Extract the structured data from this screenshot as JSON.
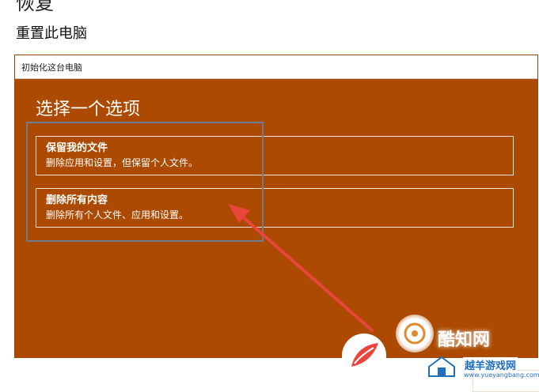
{
  "page": {
    "top_title": "恢复",
    "section_title": "重置此电脑"
  },
  "window": {
    "title": "初始化这台电脑",
    "heading": "选择一个选项",
    "options": [
      {
        "title": "保留我的文件",
        "description": "删除应用和设置，但保留个人文件。"
      },
      {
        "title": "删除所有内容",
        "description": "删除所有个人文件、应用和设置。"
      }
    ]
  },
  "colors": {
    "window_bg": "#ab4a00",
    "highlight_border": "#6a7d93",
    "annotation_arrow": "#e8453c"
  },
  "watermark": {
    "brand_text": "酷知网",
    "site_text": "越羊游戏网",
    "url_text": "www.yueyangbang.com"
  }
}
